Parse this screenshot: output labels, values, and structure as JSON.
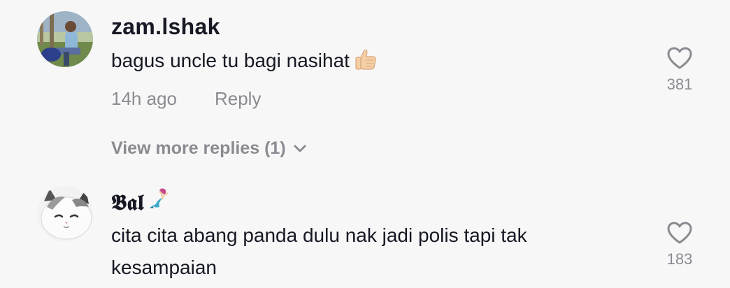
{
  "comments": [
    {
      "username": "zam.lshak",
      "text": "bagus uncle tu bagi nasihat",
      "emoji_icon": "thumbs-up-emoji",
      "time": "14h ago",
      "reply_label": "Reply",
      "likes": "381"
    },
    {
      "username": "𝕭𝖆𝖑",
      "username_emoji_icon": "mermaid-emoji",
      "text": "cita cita abang panda dulu nak jadi polis tapi tak kesampaian",
      "likes": "183"
    }
  ],
  "view_more_label": "View more replies (1)",
  "colors": {
    "background": "#f7f7f7",
    "primary_text": "#161823",
    "secondary_text": "#8a8b91"
  }
}
